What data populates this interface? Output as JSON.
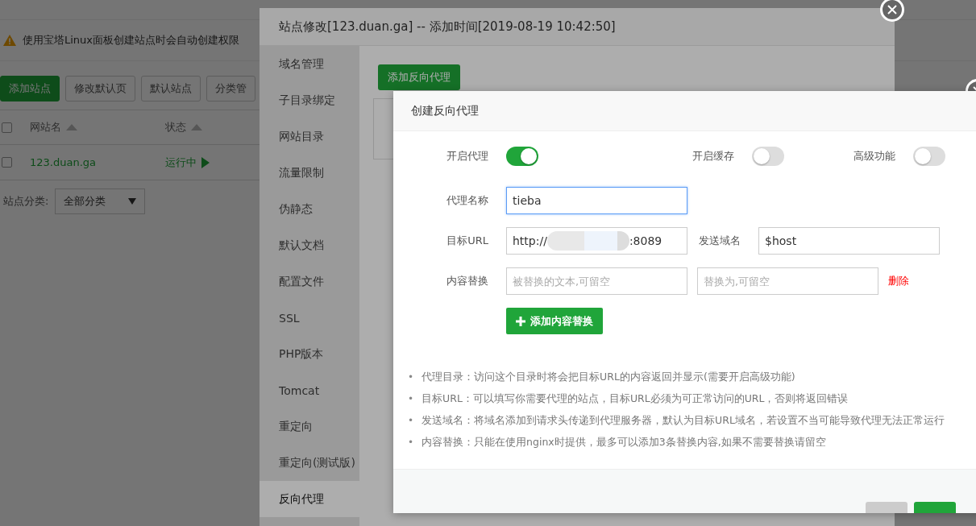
{
  "page": {
    "notice": "使用宝塔Linux面板创建站点时会自动创建权限",
    "toolbar": [
      {
        "label": "添加站点",
        "primary": true
      },
      {
        "label": "修改默认页",
        "primary": false
      },
      {
        "label": "默认站点",
        "primary": false
      },
      {
        "label": "分类管",
        "primary": false
      }
    ],
    "table": {
      "select_all_checked": false,
      "columns": [
        "网站名",
        "状态"
      ],
      "rows": [
        {
          "checked": false,
          "site": "123.duan.ga",
          "status": "运行中"
        }
      ]
    },
    "category": {
      "label": "站点分类:",
      "value": "全部分类"
    }
  },
  "site_dialog": {
    "title": "站点修改[123.duan.ga] -- 添加时间[2019-08-19 10:42:50]",
    "menu": [
      {
        "label": "域名管理",
        "selected": false
      },
      {
        "label": "子目录绑定",
        "selected": false
      },
      {
        "label": "网站目录",
        "selected": false
      },
      {
        "label": "流量限制",
        "selected": false
      },
      {
        "label": "伪静态",
        "selected": false
      },
      {
        "label": "默认文档",
        "selected": false
      },
      {
        "label": "配置文件",
        "selected": false
      },
      {
        "label": "SSL",
        "selected": false
      },
      {
        "label": "PHP版本",
        "selected": false
      },
      {
        "label": "Tomcat",
        "selected": false
      },
      {
        "label": "重定向",
        "selected": false
      },
      {
        "label": "重定向(测试版)",
        "selected": false
      },
      {
        "label": "反向代理",
        "selected": true
      }
    ],
    "add_button": "添加反向代理"
  },
  "proxy_dialog": {
    "title": "创建反向代理",
    "switches": [
      {
        "label": "开启代理",
        "on": true
      },
      {
        "label": "开启缓存",
        "on": false
      },
      {
        "label": "高级功能",
        "on": false
      }
    ],
    "name": {
      "label": "代理名称",
      "value": "tieba",
      "focused": true
    },
    "target": {
      "label": "目标URL",
      "value_start": "http://",
      "value_end": ":8089",
      "redacted": true
    },
    "send_domain": {
      "label": "发送域名",
      "value": "$host"
    },
    "replace": {
      "label": "内容替换",
      "from_placeholder": "被替换的文本,可留空",
      "to_placeholder": "替换为,可留空",
      "delete": "删除"
    },
    "add_replace": "添加内容替换",
    "hints": [
      {
        "bullet": "•",
        "text": "代理目录：访问这个目录时将会把目标URL的内容返回并显示(需要开启高级功能)"
      },
      {
        "bullet": "•",
        "text": "目标URL：可以填写你需要代理的站点，目标URL必须为可正常访问的URL，否则将返回错误"
      },
      {
        "bullet": "•",
        "text": "发送域名：将域名添加到请求头传递到代理服务器，默认为目标URL域名，若设置不当可能导致代理无法正常运行"
      },
      {
        "bullet": "•",
        "text": "内容替换：只能在使用nginx时提供，最多可以添加3条替换内容,如果不需要替换请留空"
      }
    ]
  }
}
